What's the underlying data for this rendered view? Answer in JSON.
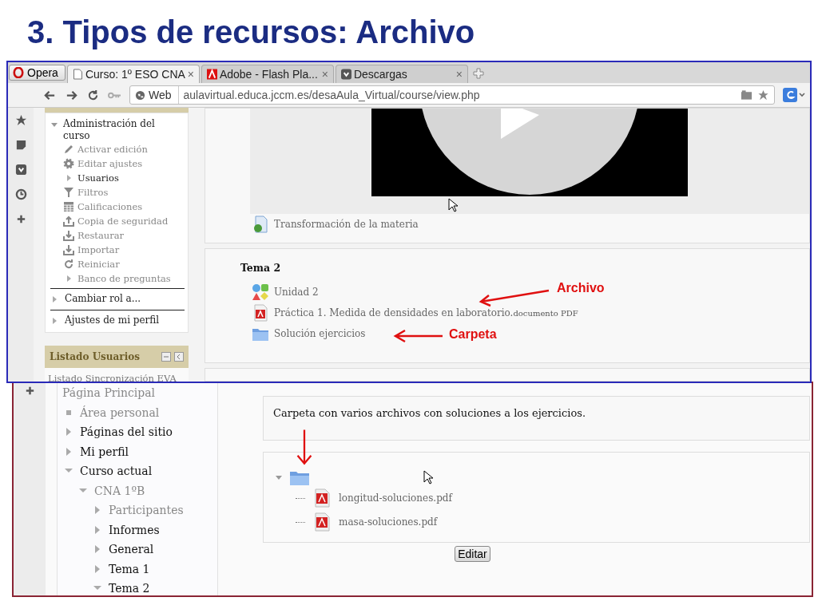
{
  "slide_title": "3. Tipos de recursos: Archivo",
  "browser": {
    "menu_button": "Opera",
    "tabs": [
      {
        "label": "Curso: 1º ESO CNA",
        "selected": true,
        "close": "×"
      },
      {
        "label": "Adobe - Flash Pla...",
        "selected": false,
        "close": "×"
      },
      {
        "label": "Descargas",
        "selected": false,
        "close": "×"
      }
    ],
    "address": {
      "badge": "Web",
      "url": "aulavirtual.educa.jccm.es/desaAula_Virtual/course/view.php"
    }
  },
  "admin_block": {
    "title": "Administración del curso",
    "expanded": true,
    "items": [
      {
        "label": "Activar edición",
        "kind": "link",
        "link": true
      },
      {
        "label": "Editar ajustes",
        "kind": "link",
        "link": true
      },
      {
        "label": "Usuarios",
        "kind": "branch",
        "link": false
      },
      {
        "label": "Filtros",
        "kind": "link",
        "link": true
      },
      {
        "label": "Calificaciones",
        "kind": "link",
        "link": true
      },
      {
        "label": "Copia de seguridad",
        "kind": "link",
        "link": true
      },
      {
        "label": "Restaurar",
        "kind": "link",
        "link": true
      },
      {
        "label": "Importar",
        "kind": "link",
        "link": true
      },
      {
        "label": "Reiniciar",
        "kind": "link",
        "link": true
      },
      {
        "label": "Banco de preguntas",
        "kind": "branch",
        "link": true
      }
    ],
    "sections": [
      {
        "label": "Cambiar rol a...",
        "expanded": false
      },
      {
        "label": "Ajustes de mi perfil",
        "expanded": false
      }
    ]
  },
  "users_block": {
    "title": "Listado Usuarios",
    "items": [
      "Listado Sincronización EVA"
    ]
  },
  "course": {
    "resource": "Transformación de la materia",
    "section_title": "Tema 2",
    "activities": [
      {
        "label": "Unidad 2",
        "kind": "lesson"
      },
      {
        "label": "Práctica 1. Medida de densidades en laboratorio.",
        "suffix": "documento PDF",
        "kind": "pdf"
      },
      {
        "label": "Solución ejercicios",
        "kind": "folder"
      }
    ],
    "annotations": [
      {
        "text": "Archivo"
      },
      {
        "text": "Carpeta"
      }
    ]
  },
  "folder_page": {
    "nav": [
      {
        "label": "Página Principal",
        "kind": "root",
        "link": true,
        "children": [
          {
            "label": "Área personal",
            "kind": "leaf",
            "link": true
          },
          {
            "label": "Páginas del sitio",
            "kind": "branch",
            "link": false,
            "expanded": false
          },
          {
            "label": "Mi perfil",
            "kind": "branch",
            "link": false,
            "expanded": false
          },
          {
            "label": "Curso actual",
            "kind": "branch",
            "link": false,
            "expanded": true,
            "children": [
              {
                "label": "CNA 1ºB",
                "kind": "branch",
                "link": true,
                "expanded": true,
                "children": [
                  {
                    "label": "Participantes",
                    "kind": "branch",
                    "link": true,
                    "expanded": false
                  },
                  {
                    "label": "Informes",
                    "kind": "branch",
                    "link": false,
                    "expanded": false
                  },
                  {
                    "label": "General",
                    "kind": "branch",
                    "link": false,
                    "expanded": false
                  },
                  {
                    "label": "Tema 1",
                    "kind": "branch",
                    "link": false,
                    "expanded": false
                  },
                  {
                    "label": "Tema 2",
                    "kind": "branch",
                    "link": false,
                    "expanded": true
                  }
                ]
              }
            ]
          }
        ]
      }
    ],
    "description": "Carpeta con varios archivos con soluciones a los ejercicios.",
    "folder_expanded": true,
    "files": [
      "longitud-soluciones.pdf",
      "masa-soluciones.pdf"
    ],
    "edit_button": "Editar"
  }
}
